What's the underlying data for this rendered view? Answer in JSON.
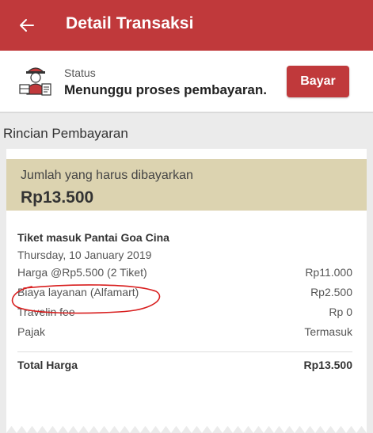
{
  "header": {
    "title": "Detail Transaksi",
    "back_icon": "arrow-left-icon"
  },
  "status": {
    "label": "Status",
    "value": "Menunggu proses pembayaran.",
    "icon": "courier-icon",
    "pay_button": "Bayar"
  },
  "section": {
    "title": "Rincian Pembayaran"
  },
  "amount_due": {
    "label": "Jumlah yang harus dibayarkan",
    "value": "Rp13.500"
  },
  "item": {
    "title": "Tiket masuk Pantai Goa Cina",
    "date": "Thursday, 10 January 2019"
  },
  "rows": [
    {
      "label": "Harga @Rp5.500 (2 Tiket)",
      "value": "Rp11.000"
    },
    {
      "label": "Biaya layanan (Alfamart)",
      "value": "Rp2.500"
    },
    {
      "label": "Travelin fee",
      "value": "Rp 0"
    },
    {
      "label": "Pajak",
      "value": "Termasuk"
    }
  ],
  "total": {
    "label": "Total Harga",
    "value": "Rp13.500"
  },
  "colors": {
    "brand": "#c0393b",
    "amount_box": "#dcd3b0",
    "annotation": "#d81e1e"
  }
}
